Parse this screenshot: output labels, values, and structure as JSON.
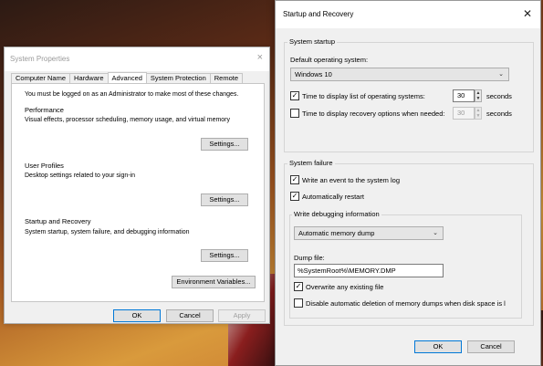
{
  "system_properties": {
    "title": "System Properties",
    "close_icon": "×",
    "tabs": [
      {
        "label": "Computer Name"
      },
      {
        "label": "Hardware"
      },
      {
        "label": "Advanced",
        "active": true
      },
      {
        "label": "System Protection"
      },
      {
        "label": "Remote"
      }
    ],
    "admin_note": "You must be logged on as an Administrator to make most of these changes.",
    "performance": {
      "heading": "Performance",
      "description": "Visual effects, processor scheduling, memory usage, and virtual memory",
      "button": "Settings..."
    },
    "user_profiles": {
      "heading": "User Profiles",
      "description": "Desktop settings related to your sign-in",
      "button": "Settings..."
    },
    "startup_recovery": {
      "heading": "Startup and Recovery",
      "description": "System startup, system failure, and debugging information",
      "button": "Settings..."
    },
    "env_button": "Environment Variables...",
    "ok": "OK",
    "cancel": "Cancel",
    "apply": "Apply"
  },
  "startup_recovery": {
    "title": "Startup and Recovery",
    "close_icon": "✕",
    "system_startup": {
      "legend": "System startup",
      "default_os_label": "Default operating system:",
      "default_os_value": "Windows 10",
      "display_list": {
        "label": "Time to display list of operating systems:",
        "checked": true,
        "value": "30",
        "unit": "seconds"
      },
      "display_recovery": {
        "label": "Time to display recovery options when needed:",
        "checked": false,
        "value": "30",
        "unit": "seconds"
      }
    },
    "system_failure": {
      "legend": "System failure",
      "write_event": {
        "label": "Write an event to the system log",
        "checked": true
      },
      "auto_restart": {
        "label": "Automatically restart",
        "checked": true
      },
      "debug": {
        "legend": "Write debugging information",
        "dump_type": "Automatic memory dump",
        "dump_file_label": "Dump file:",
        "dump_file_value": "%SystemRoot%\\MEMORY.DMP",
        "overwrite": {
          "label": "Overwrite any existing file",
          "checked": true
        },
        "disable_auto_delete": {
          "label": "Disable automatic deletion of memory dumps when disk space is l",
          "checked": false
        }
      }
    },
    "ok": "OK",
    "cancel": "Cancel"
  }
}
